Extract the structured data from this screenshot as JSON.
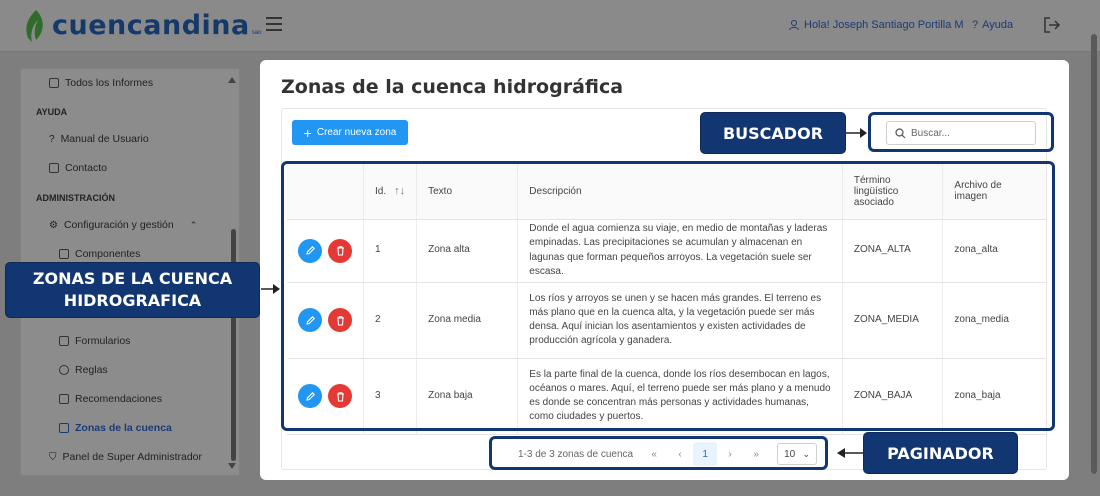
{
  "header": {
    "logo_text": "cuencandina",
    "logo_suffix": "sao",
    "user_greeting": "Hola! Joseph Santiago Portilla M",
    "help_label": "Ayuda",
    "icons": [
      "leaf-logo-icon",
      "hamburger-icon",
      "user-icon",
      "help-icon",
      "logout-icon"
    ]
  },
  "sidebar": {
    "items": [
      {
        "label": "Todos los Informes",
        "icon": "folder-icon"
      },
      {
        "label": "Manual de Usuario",
        "icon": "help-icon"
      },
      {
        "label": "Contacto",
        "icon": "mail-icon"
      },
      {
        "label": "Configuración y gestión",
        "icon": "gear-icon"
      },
      {
        "label": "Componentes",
        "icon": "grid-icon"
      },
      {
        "label": "Formularios",
        "icon": "form-icon"
      },
      {
        "label": "Reglas",
        "icon": "rule-icon"
      },
      {
        "label": "Recomendaciones",
        "icon": "list-icon"
      },
      {
        "label": "Zonas de la cuenca",
        "icon": "map-icon"
      },
      {
        "label": "Panel de Super Administrador",
        "icon": "shield-icon"
      }
    ],
    "sections": [
      "AYUDA",
      "ADMINISTRACIÓN"
    ]
  },
  "modal": {
    "title": "Zonas de la cuenca hidrográfica",
    "create_button": "Crear nueva zona",
    "search_placeholder": "Buscar...",
    "table": {
      "headers": [
        "Id.",
        "Texto",
        "Descripción",
        "Término lingüístico asociado",
        "Archivo de imagen"
      ],
      "rows": [
        {
          "id": "1",
          "texto": "Zona alta",
          "descripcion": "Donde el agua comienza su viaje, en medio de montañas y laderas empinadas. Las precipitaciones se acumulan y almacenan en lagunas que forman pequeños arroyos. La vegetación suele ser escasa.",
          "termino": "ZONA_ALTA",
          "archivo": "zona_alta"
        },
        {
          "id": "2",
          "texto": "Zona media",
          "descripcion": "Los ríos y arroyos se unen y se hacen más grandes. El terreno es más plano que en la cuenca alta, y la vegetación puede ser más densa. Aquí inician los asentamientos y existen actividades de producción agrícola y ganadera.",
          "termino": "ZONA_MEDIA",
          "archivo": "zona_media"
        },
        {
          "id": "3",
          "texto": "Zona baja",
          "descripcion": "Es la parte final de la cuenca, donde los ríos desembocan en lagos, océanos o mares. Aquí, el terreno puede ser más plano y a menudo es donde se concentran más personas y actividades humanas, como ciudades y puertos.",
          "termino": "ZONA_BAJA",
          "archivo": "zona_baja"
        }
      ]
    },
    "paginator": {
      "summary": "1-3 de 3 zonas de cuenca",
      "current_page": "1",
      "page_size": "10"
    }
  },
  "callouts": {
    "buscador": "BUSCADOR",
    "zonas_line1": "ZONAS DE LA CUENCA",
    "zonas_line2": "HIDROGRAFICA",
    "paginador": "PAGINADOR"
  },
  "colors": {
    "primary": "#2196f3",
    "danger": "#e53935",
    "callout": "#123672",
    "brand": "#153a6a"
  }
}
